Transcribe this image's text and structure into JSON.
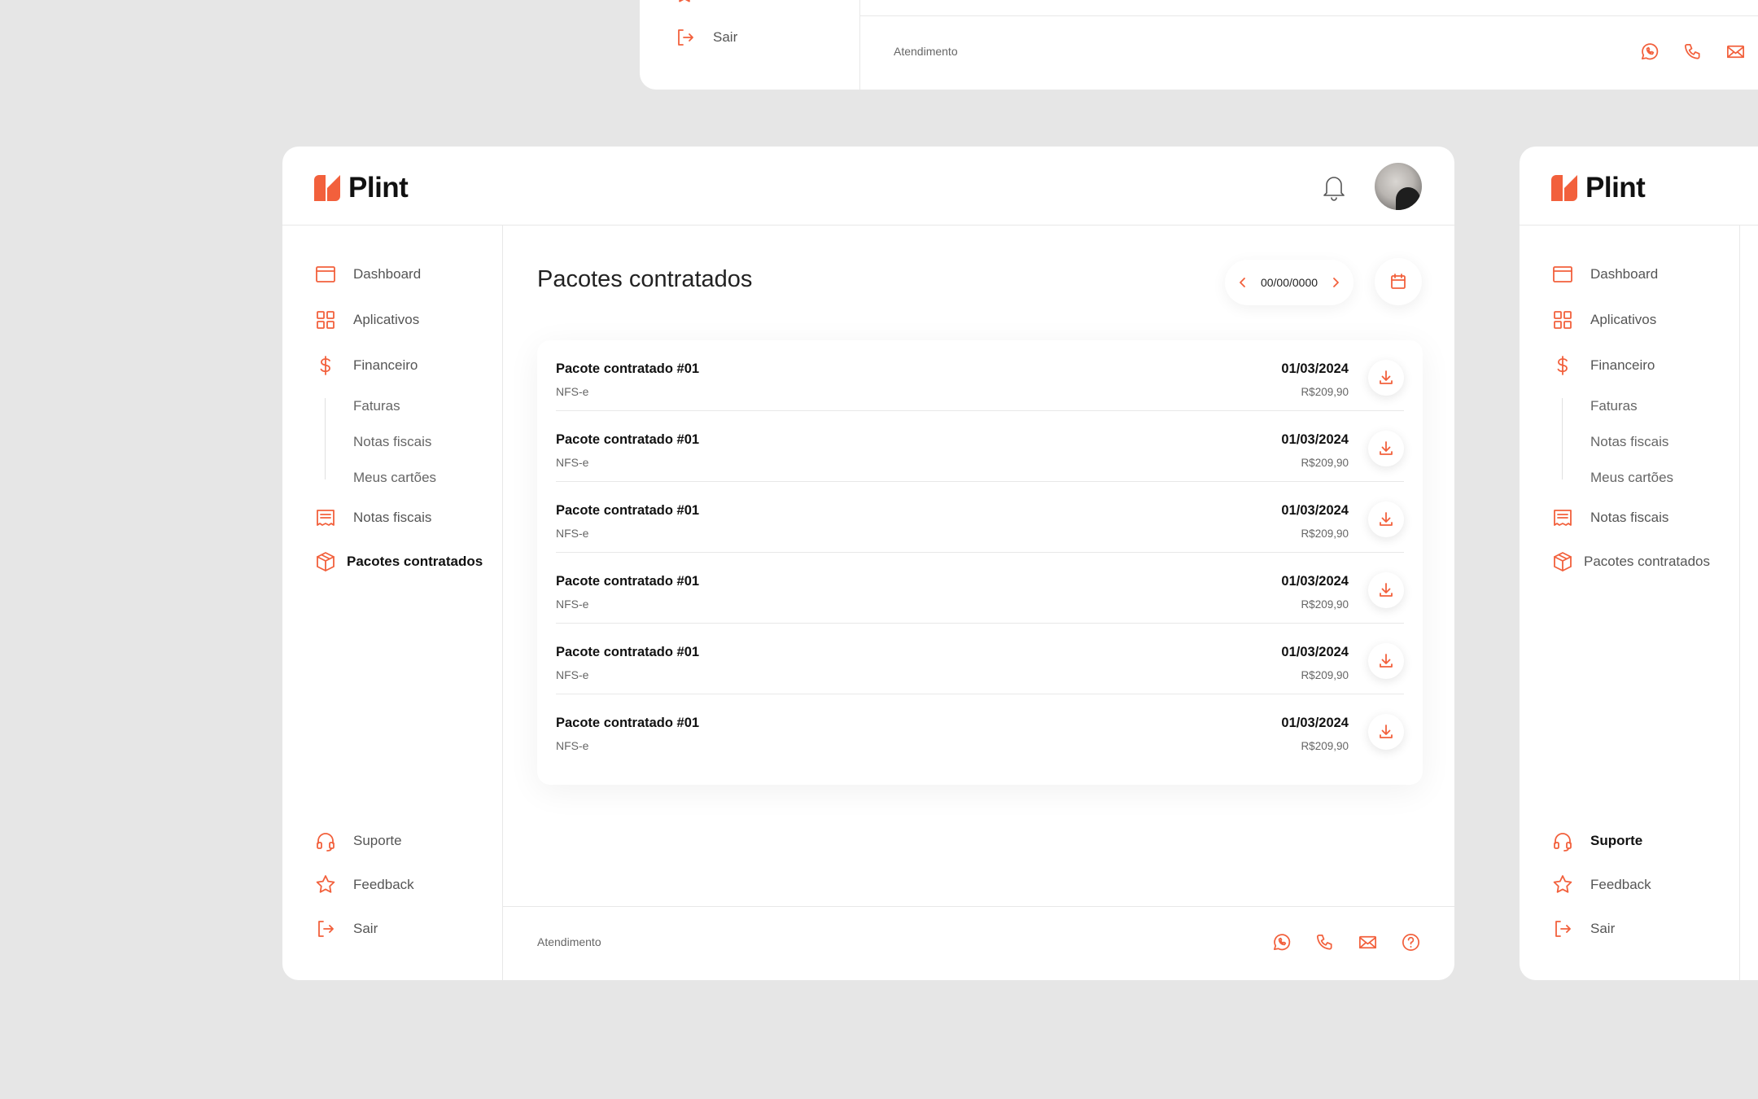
{
  "brand": {
    "name": "Plint"
  },
  "colors": {
    "accent": "#f2603c",
    "background": "#e6e6e6",
    "surface": "#ffffff"
  },
  "top_card": {
    "logout_label": "Sair",
    "footer_label": "Atendimento"
  },
  "sidebar": {
    "items": [
      {
        "label": "Dashboard",
        "icon": "browser-window-icon"
      },
      {
        "label": "Aplicativos",
        "icon": "grid-icon"
      },
      {
        "label": "Financeiro",
        "icon": "dollar-icon"
      },
      {
        "label": "Notas fiscais",
        "icon": "receipt-icon"
      },
      {
        "label": "Pacotes contratados",
        "icon": "package-icon"
      }
    ],
    "subitems": [
      "Faturas",
      "Notas fiscais",
      "Meus cartões"
    ],
    "bottom_items": [
      {
        "label": "Suporte",
        "icon": "headset-icon"
      },
      {
        "label": "Feedback",
        "icon": "star-icon"
      },
      {
        "label": "Sair",
        "icon": "logout-icon"
      }
    ]
  },
  "main": {
    "title": "Pacotes contratados",
    "date_value": "00/00/0000",
    "rows": [
      {
        "name": "Pacote contratado #01",
        "type": "NFS-e",
        "date": "01/03/2024",
        "price": "R$209,90"
      },
      {
        "name": "Pacote contratado #01",
        "type": "NFS-e",
        "date": "01/03/2024",
        "price": "R$209,90"
      },
      {
        "name": "Pacote contratado #01",
        "type": "NFS-e",
        "date": "01/03/2024",
        "price": "R$209,90"
      },
      {
        "name": "Pacote contratado #01",
        "type": "NFS-e",
        "date": "01/03/2024",
        "price": "R$209,90"
      },
      {
        "name": "Pacote contratado #01",
        "type": "NFS-e",
        "date": "01/03/2024",
        "price": "R$209,90"
      },
      {
        "name": "Pacote contratado #01",
        "type": "NFS-e",
        "date": "01/03/2024",
        "price": "R$209,90"
      }
    ]
  },
  "footer": {
    "label": "Atendimento",
    "contacts": [
      "whatsapp-icon",
      "phone-icon",
      "mail-icon",
      "help-icon"
    ]
  }
}
